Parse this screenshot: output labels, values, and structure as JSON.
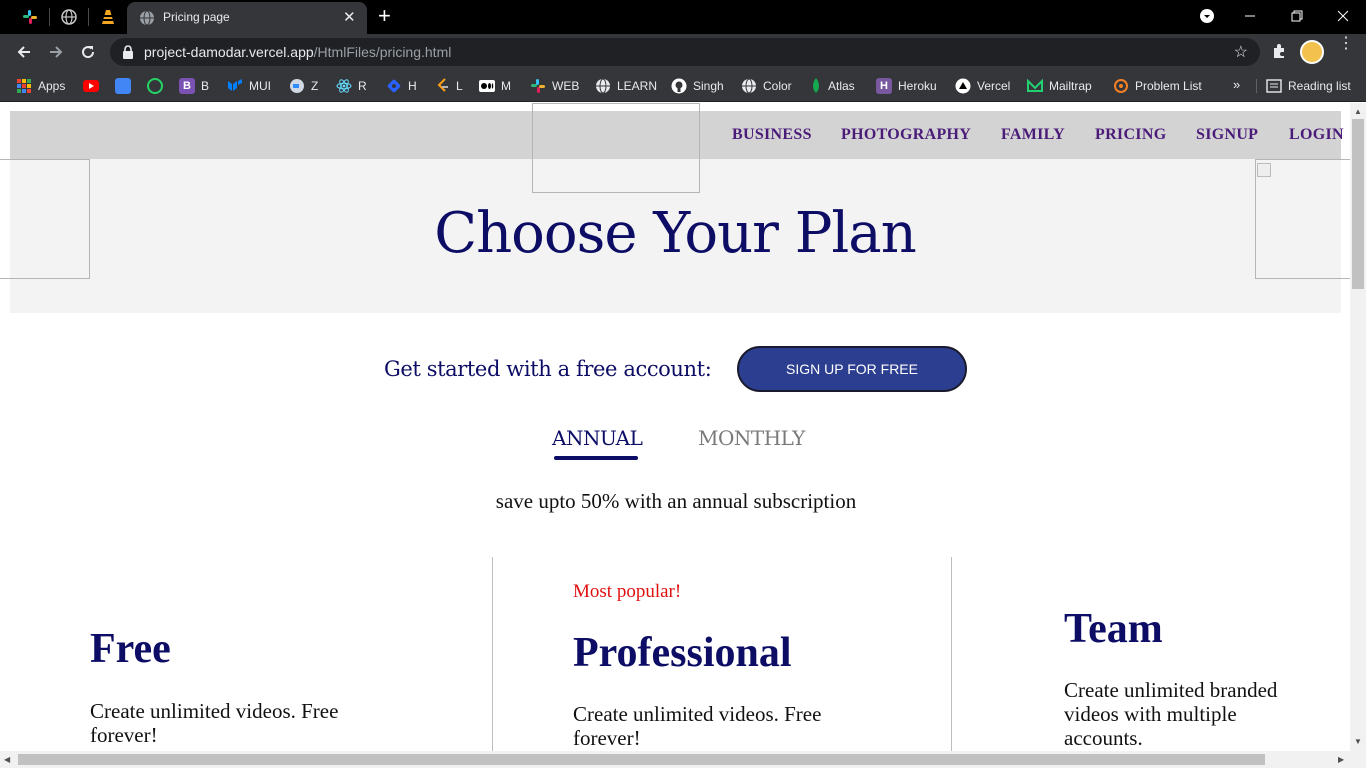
{
  "browser": {
    "active_tab_title": "Pricing page",
    "url_host": "project-damodar.vercel.app",
    "url_path": "/HtmlFiles/pricing.html",
    "bookmarks": [
      {
        "label": "Apps",
        "icon": "apps-grid-icon",
        "color": "#ea4335"
      },
      {
        "label": "",
        "icon": "youtube-icon",
        "color": "#ff0000"
      },
      {
        "label": "",
        "icon": "google-translate-icon",
        "color": "#4285f4"
      },
      {
        "label": "",
        "icon": "whatsapp-icon",
        "color": "#25d366"
      },
      {
        "label": "B",
        "icon": "bootstrap-icon",
        "color": "#7952b3"
      },
      {
        "label": "MUI",
        "icon": "mui-icon",
        "color": "#007fff"
      },
      {
        "label": "Z",
        "icon": "zoom-icon",
        "color": "#2d8cff"
      },
      {
        "label": "R",
        "icon": "react-icon",
        "color": "#61dafb"
      },
      {
        "label": "H",
        "icon": "hashnode-icon",
        "color": "#2962ff"
      },
      {
        "label": "L",
        "icon": "leetcode-icon",
        "color": "#ffa116"
      },
      {
        "label": "M",
        "icon": "medium-icon",
        "color": "#ffffff"
      },
      {
        "label": "WEB",
        "icon": "slack-icon",
        "color": "#e01e5a"
      },
      {
        "label": "LEARN",
        "icon": "globe-icon",
        "color": "#ffffff"
      },
      {
        "label": "Singh",
        "icon": "github-icon",
        "color": "#ffffff"
      },
      {
        "label": "Color",
        "icon": "globe-icon",
        "color": "#ffffff"
      },
      {
        "label": "Atlas",
        "icon": "mongodb-leaf-icon",
        "color": "#13aa52"
      },
      {
        "label": "Heroku",
        "icon": "heroku-icon",
        "color": "#79589f"
      },
      {
        "label": "Vercel",
        "icon": "vercel-triangle-icon",
        "color": "#ffffff"
      },
      {
        "label": "Mailtrap",
        "icon": "mailtrap-icon",
        "color": "#22d172"
      },
      {
        "label": "Problem List",
        "icon": "problem-list-icon",
        "color": "#f48024"
      }
    ],
    "more_label": "»",
    "reading_list_label": "Reading list"
  },
  "page": {
    "nav_links": [
      "BUSINESS",
      "PHOTOGRAPHY",
      "FAMILY",
      "PRICING",
      "SIGNUP",
      "LOGIN"
    ],
    "hero_title": "Choose Your Plan",
    "free_account_text": "Get started with a free account:",
    "signup_button": "SIGN UP FOR FREE",
    "billing_tabs": {
      "annual": "ANNUAL",
      "monthly": "MONTHLY",
      "selected": "ANNUAL"
    },
    "save_note": "save upto 50% with an annual subscription",
    "plans": [
      {
        "badge": "",
        "name": "Free",
        "description": "Create unlimited videos. Free forever!"
      },
      {
        "badge": "Most popular!",
        "name": "Professional",
        "description": "Create unlimited videos. Free forever!"
      },
      {
        "badge": "",
        "name": "Team",
        "description": "Create unlimited branded videos with multiple accounts."
      }
    ]
  },
  "colors": {
    "heading_navy": "#0d0d66",
    "nav_purple": "#4b1b7a",
    "button_blue": "#2c3e8f",
    "popular_red": "#e01010"
  }
}
